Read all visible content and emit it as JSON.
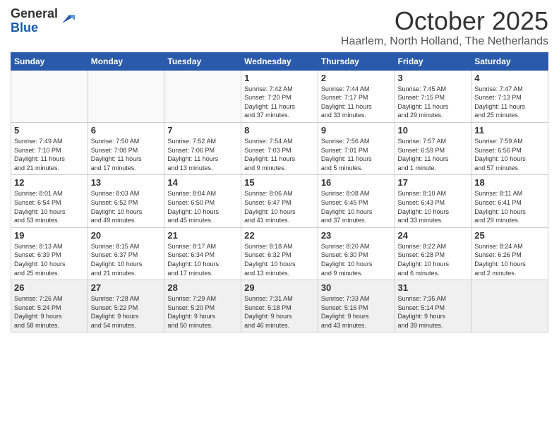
{
  "header": {
    "logo_general": "General",
    "logo_blue": "Blue",
    "month_title": "October 2025",
    "location": "Haarlem, North Holland, The Netherlands"
  },
  "weekdays": [
    "Sunday",
    "Monday",
    "Tuesday",
    "Wednesday",
    "Thursday",
    "Friday",
    "Saturday"
  ],
  "weeks": [
    [
      {
        "day": "",
        "info": ""
      },
      {
        "day": "",
        "info": ""
      },
      {
        "day": "",
        "info": ""
      },
      {
        "day": "1",
        "info": "Sunrise: 7:42 AM\nSunset: 7:20 PM\nDaylight: 11 hours\nand 37 minutes."
      },
      {
        "day": "2",
        "info": "Sunrise: 7:44 AM\nSunset: 7:17 PM\nDaylight: 11 hours\nand 33 minutes."
      },
      {
        "day": "3",
        "info": "Sunrise: 7:45 AM\nSunset: 7:15 PM\nDaylight: 11 hours\nand 29 minutes."
      },
      {
        "day": "4",
        "info": "Sunrise: 7:47 AM\nSunset: 7:13 PM\nDaylight: 11 hours\nand 25 minutes."
      }
    ],
    [
      {
        "day": "5",
        "info": "Sunrise: 7:49 AM\nSunset: 7:10 PM\nDaylight: 11 hours\nand 21 minutes."
      },
      {
        "day": "6",
        "info": "Sunrise: 7:50 AM\nSunset: 7:08 PM\nDaylight: 11 hours\nand 17 minutes."
      },
      {
        "day": "7",
        "info": "Sunrise: 7:52 AM\nSunset: 7:06 PM\nDaylight: 11 hours\nand 13 minutes."
      },
      {
        "day": "8",
        "info": "Sunrise: 7:54 AM\nSunset: 7:03 PM\nDaylight: 11 hours\nand 9 minutes."
      },
      {
        "day": "9",
        "info": "Sunrise: 7:56 AM\nSunset: 7:01 PM\nDaylight: 11 hours\nand 5 minutes."
      },
      {
        "day": "10",
        "info": "Sunrise: 7:57 AM\nSunset: 6:59 PM\nDaylight: 11 hours\nand 1 minute."
      },
      {
        "day": "11",
        "info": "Sunrise: 7:59 AM\nSunset: 6:56 PM\nDaylight: 10 hours\nand 57 minutes."
      }
    ],
    [
      {
        "day": "12",
        "info": "Sunrise: 8:01 AM\nSunset: 6:54 PM\nDaylight: 10 hours\nand 53 minutes."
      },
      {
        "day": "13",
        "info": "Sunrise: 8:03 AM\nSunset: 6:52 PM\nDaylight: 10 hours\nand 49 minutes."
      },
      {
        "day": "14",
        "info": "Sunrise: 8:04 AM\nSunset: 6:50 PM\nDaylight: 10 hours\nand 45 minutes."
      },
      {
        "day": "15",
        "info": "Sunrise: 8:06 AM\nSunset: 6:47 PM\nDaylight: 10 hours\nand 41 minutes."
      },
      {
        "day": "16",
        "info": "Sunrise: 8:08 AM\nSunset: 6:45 PM\nDaylight: 10 hours\nand 37 minutes."
      },
      {
        "day": "17",
        "info": "Sunrise: 8:10 AM\nSunset: 6:43 PM\nDaylight: 10 hours\nand 33 minutes."
      },
      {
        "day": "18",
        "info": "Sunrise: 8:11 AM\nSunset: 6:41 PM\nDaylight: 10 hours\nand 29 minutes."
      }
    ],
    [
      {
        "day": "19",
        "info": "Sunrise: 8:13 AM\nSunset: 6:39 PM\nDaylight: 10 hours\nand 25 minutes."
      },
      {
        "day": "20",
        "info": "Sunrise: 8:15 AM\nSunset: 6:37 PM\nDaylight: 10 hours\nand 21 minutes."
      },
      {
        "day": "21",
        "info": "Sunrise: 8:17 AM\nSunset: 6:34 PM\nDaylight: 10 hours\nand 17 minutes."
      },
      {
        "day": "22",
        "info": "Sunrise: 8:18 AM\nSunset: 6:32 PM\nDaylight: 10 hours\nand 13 minutes."
      },
      {
        "day": "23",
        "info": "Sunrise: 8:20 AM\nSunset: 6:30 PM\nDaylight: 10 hours\nand 9 minutes."
      },
      {
        "day": "24",
        "info": "Sunrise: 8:22 AM\nSunset: 6:28 PM\nDaylight: 10 hours\nand 6 minutes."
      },
      {
        "day": "25",
        "info": "Sunrise: 8:24 AM\nSunset: 6:26 PM\nDaylight: 10 hours\nand 2 minutes."
      }
    ],
    [
      {
        "day": "26",
        "info": "Sunrise: 7:26 AM\nSunset: 5:24 PM\nDaylight: 9 hours\nand 58 minutes."
      },
      {
        "day": "27",
        "info": "Sunrise: 7:28 AM\nSunset: 5:22 PM\nDaylight: 9 hours\nand 54 minutes."
      },
      {
        "day": "28",
        "info": "Sunrise: 7:29 AM\nSunset: 5:20 PM\nDaylight: 9 hours\nand 50 minutes."
      },
      {
        "day": "29",
        "info": "Sunrise: 7:31 AM\nSunset: 5:18 PM\nDaylight: 9 hours\nand 46 minutes."
      },
      {
        "day": "30",
        "info": "Sunrise: 7:33 AM\nSunset: 5:16 PM\nDaylight: 9 hours\nand 43 minutes."
      },
      {
        "day": "31",
        "info": "Sunrise: 7:35 AM\nSunset: 5:14 PM\nDaylight: 9 hours\nand 39 minutes."
      },
      {
        "day": "",
        "info": ""
      }
    ]
  ]
}
